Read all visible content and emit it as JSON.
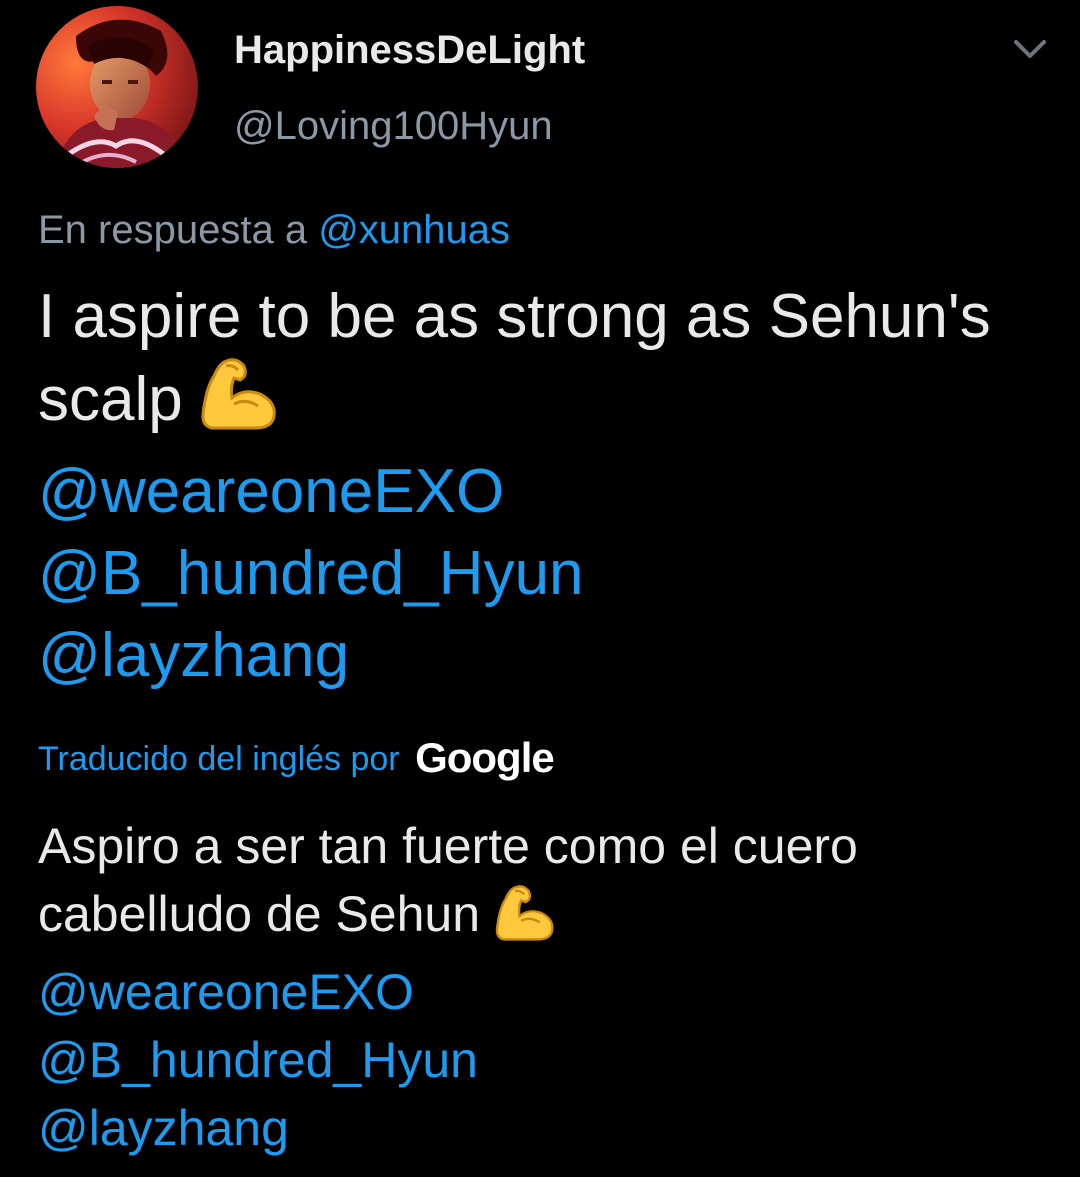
{
  "header": {
    "display_name": "HappinessDeLight",
    "handle": "@Loving100Hyun",
    "avatar_icon": "profile-photo",
    "menu_icon": "chevron-down-icon"
  },
  "reply": {
    "prefix": "En respuesta a",
    "mention": "@xunhuas"
  },
  "tweet": {
    "line1": "I aspire to be as strong as Sehun's",
    "line2": "scalp",
    "emoji": "flexed-biceps",
    "mentions": [
      "@weareoneEXO",
      "@B_hundred_Hyun",
      "@layzhang"
    ]
  },
  "translation": {
    "label": "Traducido del inglés por",
    "provider": "Google",
    "line1": "Aspiro a ser tan fuerte como el cuero",
    "line2": "cabelludo de Sehun",
    "emoji": "flexed-biceps",
    "mentions": [
      "@weareoneEXO",
      "@B_hundred_Hyun",
      "@layzhang"
    ]
  },
  "colors": {
    "background": "#000000",
    "primary_text": "#e7e9ea",
    "secondary_text": "#8b98a5",
    "link": "#1d9bf0"
  }
}
